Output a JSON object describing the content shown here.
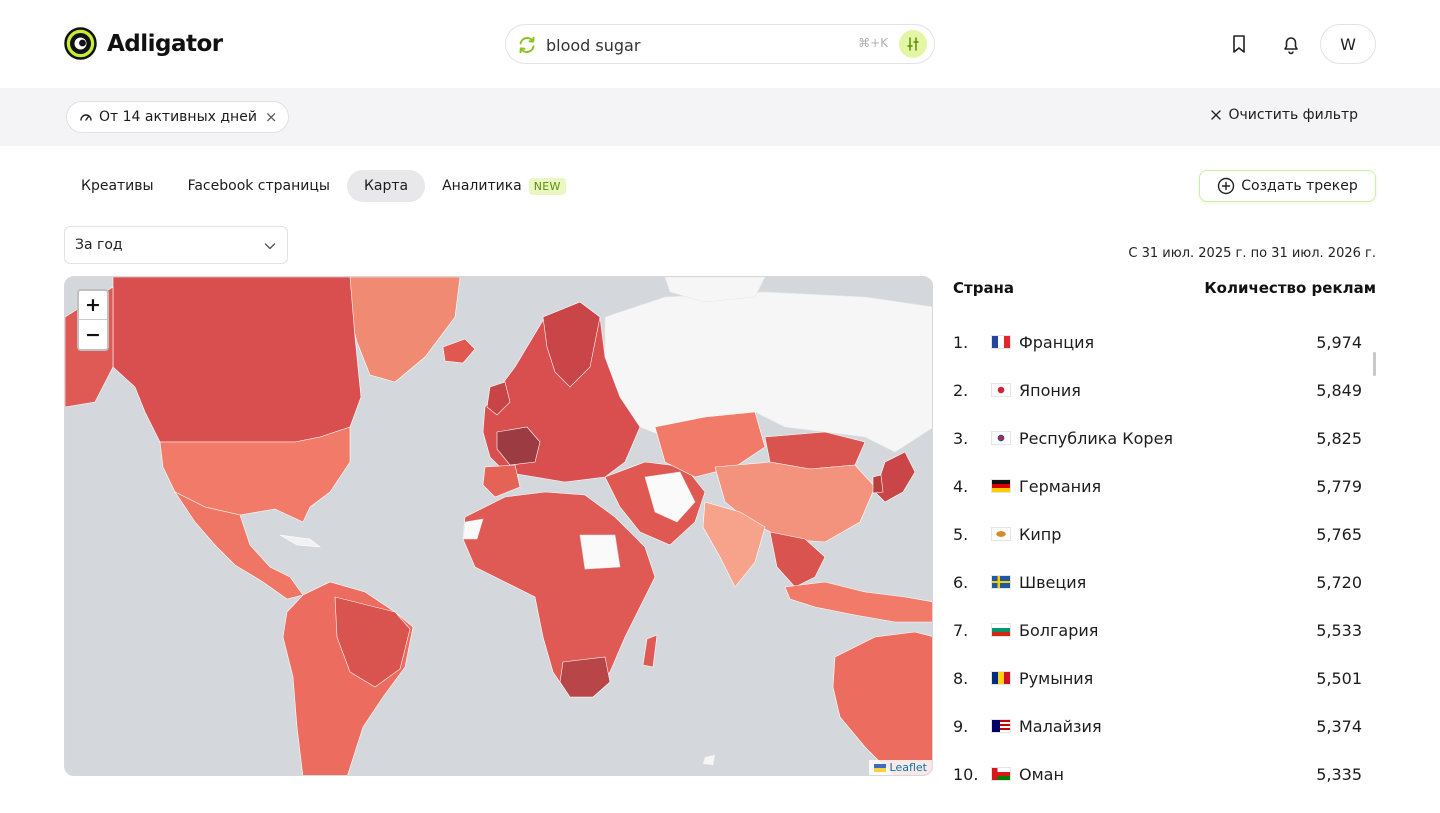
{
  "brand": {
    "name": "Adligator",
    "accent": "#c6ee33"
  },
  "search": {
    "value": "blood sugar",
    "shortcut": "⌘+K"
  },
  "header": {
    "avatar_initial": "W"
  },
  "filter": {
    "chip_label": "От 14 активных дней",
    "clear_label": "Очистить фильтр"
  },
  "tabs": [
    {
      "label": "Креативы"
    },
    {
      "label": "Facebook страницы"
    },
    {
      "label": "Карта"
    },
    {
      "label": "Аналитика"
    }
  ],
  "tab_badge": "NEW",
  "create_tracker_label": "Создать трекер",
  "period": {
    "selected": "За год"
  },
  "date_range": "С 31 июл. 2025 г. по 31 июл. 2026 г.",
  "map": {
    "zoom_in": "+",
    "zoom_out": "−",
    "attribution": "Leaflet"
  },
  "table": {
    "col_country": "Страна",
    "col_count": "Количество реклам",
    "rows": [
      {
        "rank": "1.",
        "country": "Франция",
        "count": "5,974",
        "flag": "fr-flag"
      },
      {
        "rank": "2.",
        "country": "Япония",
        "count": "5,849",
        "flag": "jp-flag"
      },
      {
        "rank": "3.",
        "country": "Республика Корея",
        "count": "5,825",
        "flag": "kr-flag"
      },
      {
        "rank": "4.",
        "country": "Германия",
        "count": "5,779",
        "flag": "de-flag"
      },
      {
        "rank": "5.",
        "country": "Кипр",
        "count": "5,765",
        "flag": "cy-flag"
      },
      {
        "rank": "6.",
        "country": "Швеция",
        "count": "5,720",
        "flag": "se-flag"
      },
      {
        "rank": "7.",
        "country": "Болгария",
        "count": "5,533",
        "flag": "bg-flag"
      },
      {
        "rank": "8.",
        "country": "Румыния",
        "count": "5,501",
        "flag": "ro-flag"
      },
      {
        "rank": "9.",
        "country": "Малайзия",
        "count": "5,374",
        "flag": "my-flag"
      },
      {
        "rank": "10.",
        "country": "Оман",
        "count": "5,335",
        "flag": "om-flag"
      }
    ]
  }
}
